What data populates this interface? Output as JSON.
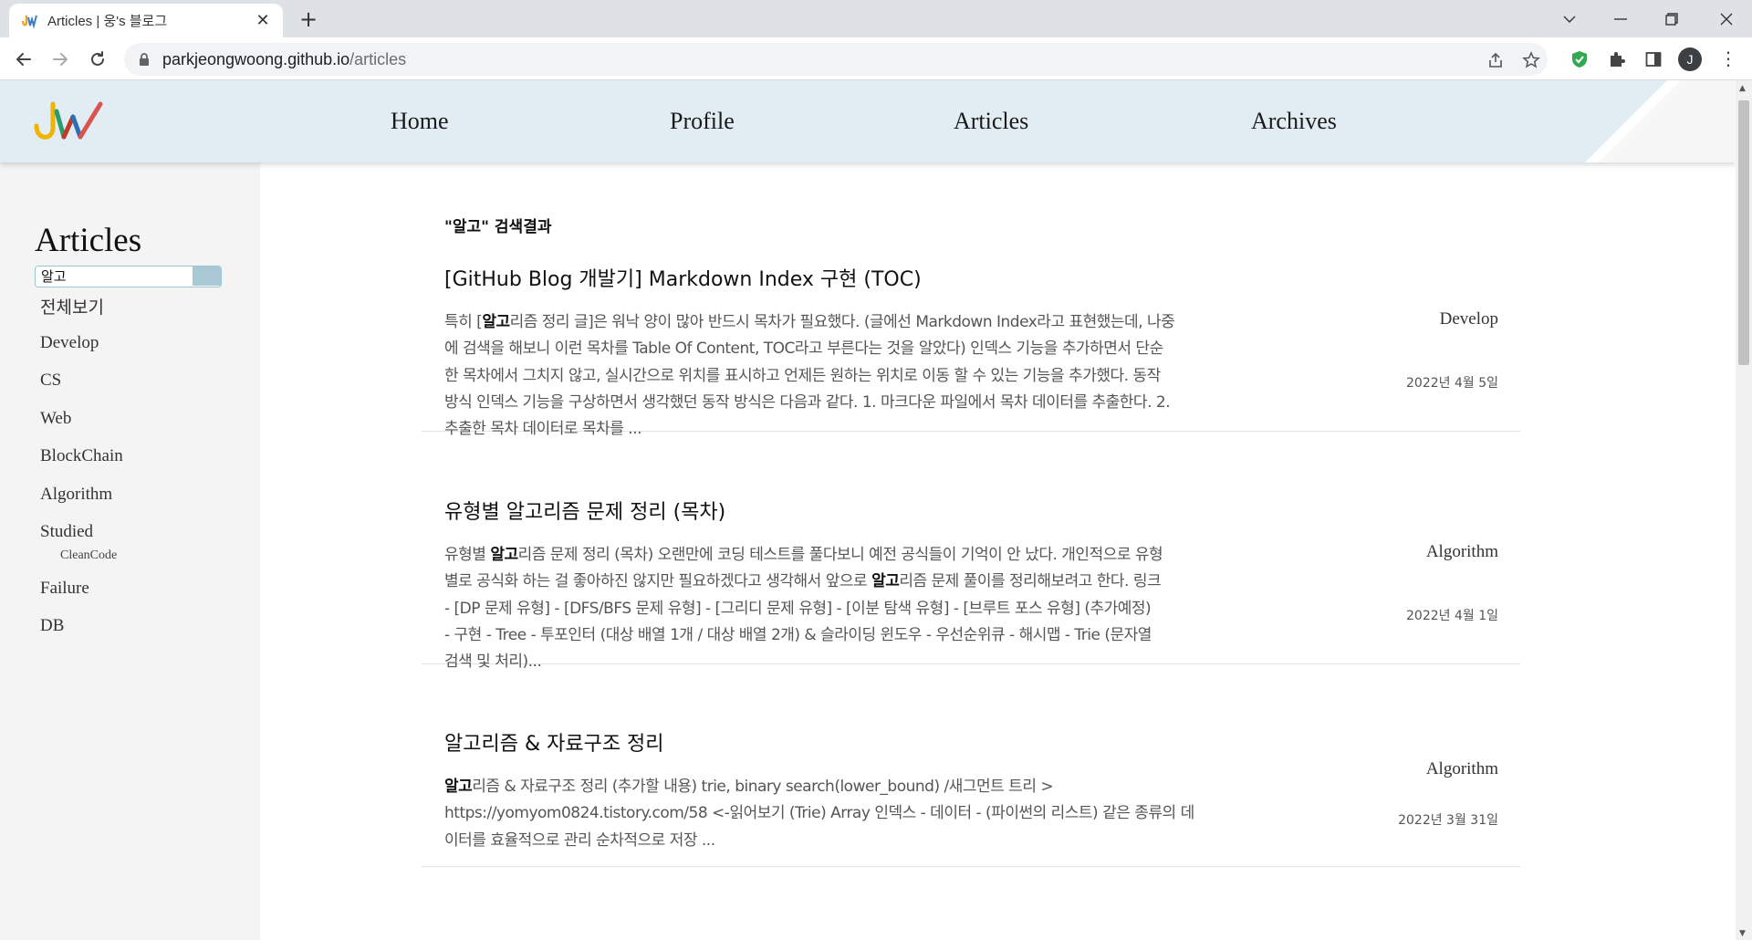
{
  "browser": {
    "tab_title": "Articles | 웅's 블로그",
    "url_host": "parkjeongwoong.github.io",
    "url_path": "/articles",
    "profile_initial": "J"
  },
  "site": {
    "nav": [
      "Home",
      "Profile",
      "Articles",
      "Archives"
    ]
  },
  "sidebar": {
    "title": "Articles",
    "search_value": "알고",
    "categories": [
      "전체보기",
      "Develop",
      "CS",
      "Web",
      "BlockChain",
      "Algorithm",
      "Studied",
      "Failure",
      "DB"
    ],
    "subcategory": "CleanCode"
  },
  "results": {
    "heading": "\"알고\" 검색결과",
    "posts": [
      {
        "title": "[GitHub Blog 개발기] Markdown Index 구현 (TOC)",
        "lines": [
          [
            "특히 [",
            "알고",
            "리즘 정리 글]은 워낙 양이 많아 반드시 목차가 필요했다. (글에선 Markdown Index라고 표현했는데, 나중"
          ],
          [
            "에 검색을 해보니 이런 목차를 Table Of Content, TOC라고 부른다는 것을 알았다) 인덱스 기능을 추가하면서 단순"
          ],
          [
            "한 목차에서 그치지 않고, 실시간으로 위치를 표시하고 언제든 원하는 위치로 이동 할 수 있는 기능을 추가했다. 동작"
          ],
          [
            "방식 인덱스 기능을 구상하면서 생각했던 동작 방식은 다음과 같다. 1. 마크다운 파일에서 목차 데이터를 추출한다. 2."
          ],
          [
            "추출한 목차 데이터로 목차를 ..."
          ]
        ],
        "category": "Develop",
        "date": "2022년 4월 5일"
      },
      {
        "title": "유형별 알고리즘 문제 정리 (목차)",
        "lines": [
          [
            "유형별 ",
            "알고",
            "리즘 문제 정리 (목차) 오랜만에 코딩 테스트를 풀다보니 예전 공식들이 기억이 안 났다. 개인적으로 유형"
          ],
          [
            "별로 공식화 하는 걸 좋아하진 않지만 필요하겠다고 생각해서 앞으로 ",
            "알고",
            "리즘 문제 풀이를 정리해보려고 한다. 링크"
          ],
          [
            "- [DP 문제 유형] - [DFS/BFS 문제 유형] - [그리디 문제 유형] - [이분 탐색 유형] - [브루트 포스 유형] (추가예정)"
          ],
          [
            "- 구현 - Tree - 투포인터 (대상 배열 1개 / 대상 배열 2개) & 슬라이딩 윈도우 - 우선순위큐 - 해시맵 - Trie (문자열"
          ],
          [
            "검색 및 처리)..."
          ]
        ],
        "category": "Algorithm",
        "date": "2022년 4월 1일"
      },
      {
        "title": "알고리즘 & 자료구조 정리",
        "lines": [
          [
            "",
            "알고",
            "리즘 & 자료구조 정리 (추가할 내용) trie, binary search(lower_bound) /새그먼트 트리 >"
          ],
          [
            "https://yomyom0824.tistory.com/58 <-읽어보기 (Trie) Array 인덱스 - 데이터 - (파이썬의 리스트) 같은 종류의 데"
          ],
          [
            "이터를 효율적으로 관리 순차적으로 저장 ..."
          ]
        ],
        "category": "Algorithm",
        "date": "2022년 3월 31일"
      }
    ]
  },
  "colors": {
    "header_band": "#e1edf2",
    "sidebar_bg": "#f4f4f4",
    "search_accent": "#a8c8d6",
    "shield": "#34a853"
  }
}
